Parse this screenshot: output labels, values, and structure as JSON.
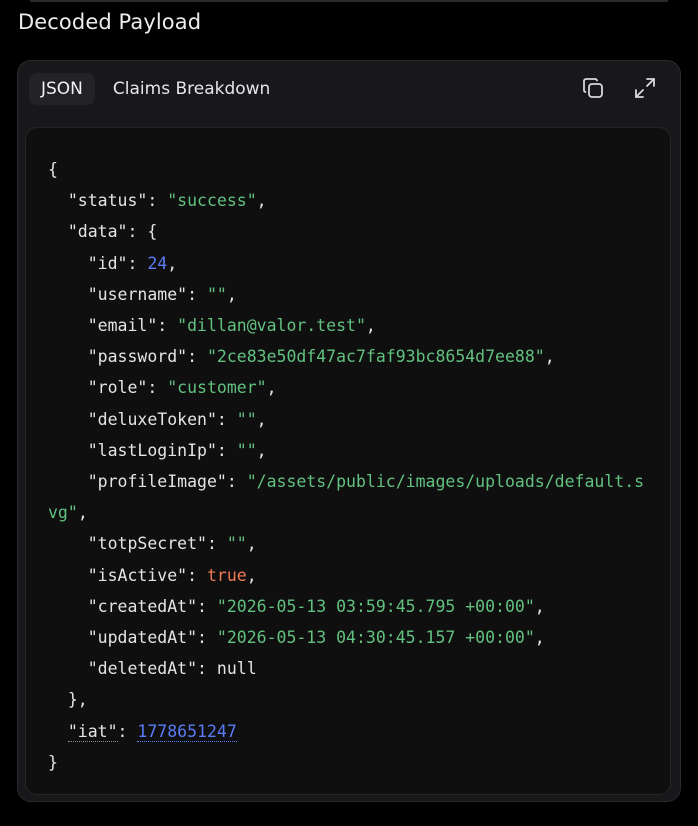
{
  "page": {
    "section_title": "Decoded Payload"
  },
  "tabs": [
    {
      "label": "JSON",
      "active": true
    },
    {
      "label": "Claims Breakdown",
      "active": false
    }
  ],
  "toolbar": {
    "copy_icon": "copy-icon",
    "expand_icon": "expand-icon"
  },
  "json_view": {
    "open_brace": "{",
    "close_brace": "}",
    "status_key": "\"status\"",
    "status_value": "\"success\"",
    "data_key": "\"data\"",
    "data_open": "{",
    "data_close": "},",
    "fields": {
      "id_key": "\"id\"",
      "id_value": "24",
      "username_key": "\"username\"",
      "username_value": "\"\"",
      "email_key": "\"email\"",
      "email_value": "\"dillan@valor.test\"",
      "password_key": "\"password\"",
      "password_value": "\"2ce83e50df47ac7faf93bc8654d7ee88\"",
      "role_key": "\"role\"",
      "role_value": "\"customer\"",
      "deluxeToken_key": "\"deluxeToken\"",
      "deluxeToken_value": "\"\"",
      "lastLoginIp_key": "\"lastLoginIp\"",
      "lastLoginIp_value": "\"\"",
      "profileImage_key": "\"profileImage\"",
      "profileImage_value": "\"/assets/public/images/uploads/default.svg\"",
      "totpSecret_key": "\"totpSecret\"",
      "totpSecret_value": "\"\"",
      "isActive_key": "\"isActive\"",
      "isActive_value": "true",
      "createdAt_key": "\"createdAt\"",
      "createdAt_value": "\"2026-05-13 03:59:45.795 +00:00\"",
      "updatedAt_key": "\"updatedAt\"",
      "updatedAt_value": "\"2026-05-13 04:30:45.157 +00:00\"",
      "deletedAt_key": "\"deletedAt\"",
      "deletedAt_value": "null"
    },
    "iat_key": "\"iat\"",
    "iat_value": "1778651247"
  },
  "colors": {
    "string": "#62c17f",
    "number": "#5b7bf5",
    "boolean": "#f07a55",
    "text": "#e4e4e6",
    "panel": "#0f0f10",
    "card": "#18181b"
  }
}
